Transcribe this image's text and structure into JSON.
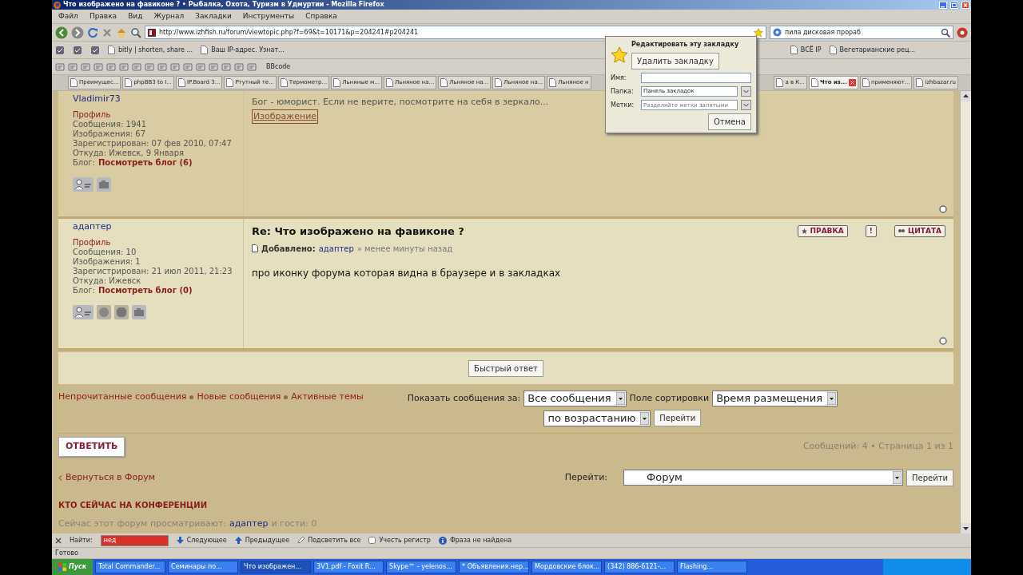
{
  "window": {
    "title": "Что изображено на фавиконе ? • Рыбалка, Охота, Туризм в Удмуртии - Mozilla Firefox"
  },
  "menu": [
    "Файл",
    "Правка",
    "Вид",
    "Журнал",
    "Закладки",
    "Инструменты",
    "Справка"
  ],
  "address": {
    "url": "http://www.izhfish.ru/forum/viewtopic.php?f=69&t=10171&p=204241#p204241"
  },
  "search": {
    "value": "пила дисковая прораб"
  },
  "bookmarks": [
    {
      "label": "bitly | shorten, share ..."
    },
    {
      "label": "Ваш IP-адрес. Узнат..."
    },
    {
      "label": "ВСЁ IP"
    },
    {
      "label": "Вегетарианские рец..."
    }
  ],
  "format_toolbar": {
    "mode": "BBcode"
  },
  "tabs": [
    {
      "label": "Преимущес...",
      "selected": false
    },
    {
      "label": "phpBB3 to I...",
      "selected": false
    },
    {
      "label": "IP.Board 3...",
      "selected": false
    },
    {
      "label": "Ртутный те...",
      "selected": false
    },
    {
      "label": "Термометр...",
      "selected": false
    },
    {
      "label": "Льняные м...",
      "selected": false
    },
    {
      "label": "Льняное на...",
      "selected": false
    },
    {
      "label": "Льняное на...",
      "selected": false
    },
    {
      "label": "Льняное на...",
      "selected": false
    },
    {
      "label": "Льняное н",
      "selected": false
    },
    {
      "label": "а в К...",
      "selected": false
    },
    {
      "label": "Что из...",
      "selected": true
    },
    {
      "label": "применяют...",
      "selected": false
    },
    {
      "label": "izhbazar.ru",
      "selected": false
    }
  ],
  "bookmark_popup": {
    "title": "Редактировать эту закладку",
    "remove": "Удалить закладку",
    "name_label": "Имя:",
    "folder_label": "Папка:",
    "folder": "Панель закладок",
    "tags_label": "Метки:",
    "tags_placeholder": "Разделяйте метки запятыми",
    "cancel": "Отмена"
  },
  "posts": [
    {
      "author": "Vladimir73",
      "profile": "Профиль",
      "stats": [
        "Сообщения: 1941",
        "Изображения: 67",
        "Зарегистрирован: 07 фев 2010, 07:47",
        "Откуда: Ижевск, 9 Января"
      ],
      "blog_label": "Блог:",
      "blog_link": "Посмотреть блог (6)",
      "contacts": [
        {
          "kind": "pm"
        },
        {
          "kind": "camera"
        }
      ],
      "signature": "Бог - юморист. Если не верите, посмотрите на себя в зеркало...",
      "image_link": "Изображение"
    },
    {
      "author": "адаптер",
      "profile": "Профиль",
      "stats": [
        "Сообщения: 10",
        "Изображения: 1",
        "Зарегистрирован: 21 июл 2011, 21:23",
        "Откуда: Ижевск"
      ],
      "blog_label": "Блог:",
      "blog_link": "Посмотреть блог (0)",
      "contacts": [
        {
          "kind": "pm"
        },
        {
          "kind": "globe"
        },
        {
          "kind": "octagon"
        },
        {
          "kind": "camera"
        }
      ],
      "title": "Re: Что изображено на фавиконе ?",
      "meta_label": "Добавлено:",
      "meta_author": "адаптер",
      "meta_time": "» менее минуты назад",
      "body": "про иконку форума которая видна в браузере и в закладках",
      "actions": [
        {
          "kind": "edit",
          "label": "ПРАВКА"
        },
        {
          "kind": "report",
          "label": "!"
        },
        {
          "kind": "quote",
          "label": "ЦИТАТА"
        }
      ]
    }
  ],
  "quick_reply": "Быстрый ответ",
  "nav_links": [
    "Непрочитанные сообщения",
    "Новые сообщения",
    "Активные темы"
  ],
  "sort": {
    "show_label": "Показать сообщения за:",
    "show": "Все сообщения",
    "field_label": "Поле сортировки",
    "field": "Время размещения",
    "order": "по возрастанию",
    "go": "Перейти"
  },
  "reply_button": "ОТВЕТИТЬ",
  "pagination": "Сообщений: 4 • Страница 1 из 1",
  "back_link": "Вернуться в Форум",
  "jump": {
    "label": "Перейти:",
    "value": "Форум",
    "go": "Перейти"
  },
  "online": {
    "heading": "КТО СЕЙЧАС НА КОНФЕРЕНЦИИ",
    "prefix": "Сейчас этот форум просматривают:",
    "user": "адаптер",
    "suffix": "и гости: 0"
  },
  "find_bar": {
    "label": "Найти:",
    "value": "нед",
    "not_found": true,
    "next": "Следующее",
    "prev": "Предыдущее",
    "highlight": "Подсветить все",
    "match_case": "Учесть регистр",
    "match_case_checked": false,
    "status": "Фраза не найдена"
  },
  "status_bar": "Готово",
  "taskbar": {
    "start": "Пуск",
    "items": [
      {
        "label": "Total Commander...",
        "selected": false
      },
      {
        "label": "Семинары по...",
        "selected": false
      },
      {
        "label": "Что изображен...",
        "selected": true
      },
      {
        "label": "3V1.pdf - Foxit R...",
        "selected": false
      },
      {
        "label": "Skype™ - yelenos...",
        "selected": false
      },
      {
        "label": "* Объявления.нер...",
        "selected": false
      },
      {
        "label": "Мордовские блок...",
        "selected": false
      },
      {
        "label": "(342) 886-6121-...",
        "selected": false
      },
      {
        "label": "Flashing...",
        "selected": false
      }
    ]
  }
}
